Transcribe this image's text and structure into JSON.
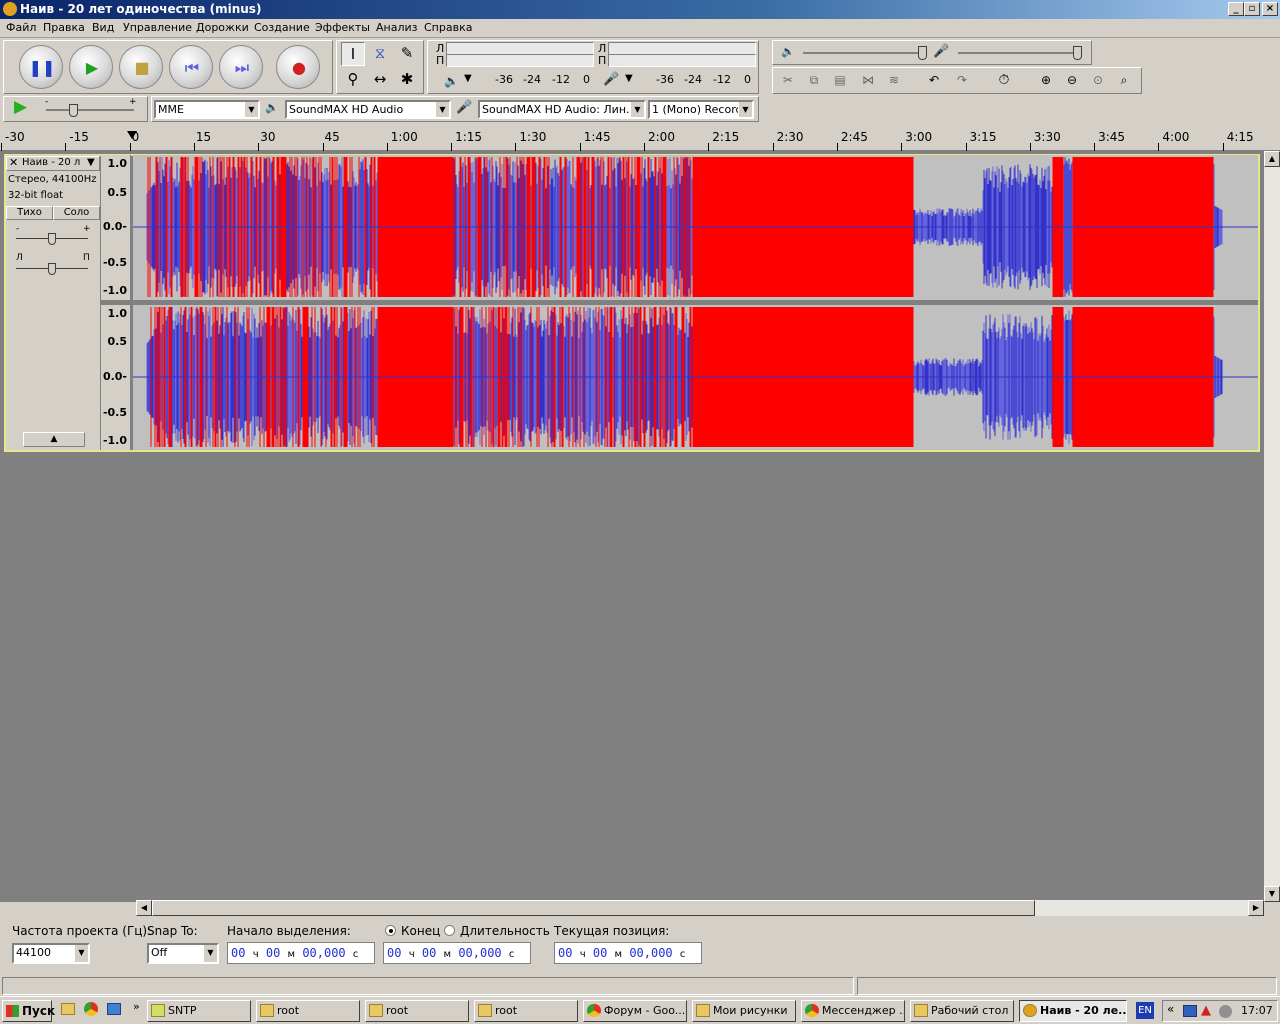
{
  "window": {
    "title": "Наив - 20 лет одиночества (minus)",
    "minimize": "_",
    "restore": "▫",
    "close": "×"
  },
  "menu": [
    "Файл",
    "Правка",
    "Вид",
    "Управление",
    "Дорожки",
    "Создание",
    "Эффекты",
    "Анализ",
    "Справка"
  ],
  "meters": {
    "play_channels": [
      "Л",
      "П"
    ],
    "rec_channels": [
      "Л",
      "П"
    ],
    "play_scale": [
      "-36",
      "-24",
      "-12",
      "0"
    ],
    "rec_scale": [
      "-36",
      "-24",
      "-12",
      "0"
    ]
  },
  "device": {
    "host": "MME",
    "output": "SoundMAX HD Audio",
    "input": "SoundMAX HD Audio: Лин. вход",
    "channels": "1 (Mono) Recording"
  },
  "playback_speed": {
    "minus": "-",
    "plus": "+"
  },
  "ruler": {
    "labels": [
      "-30",
      "-15",
      "0",
      "15",
      "30",
      "45",
      "1:00",
      "1:15",
      "1:30",
      "1:45",
      "2:00",
      "2:15",
      "2:30",
      "2:45",
      "3:00",
      "3:15",
      "3:30",
      "3:45",
      "4:00",
      "4:15"
    ]
  },
  "track": {
    "name": "Наив - 20 л",
    "format": "Стерео, 44100Hz",
    "bitdepth": "32-bit float",
    "mute": "Тихо",
    "solo": "Соло",
    "gain_minus": "-",
    "gain_plus": "+",
    "pan_left": "Л",
    "pan_right": "П",
    "scale": [
      "1.0",
      "0.5",
      "0.0-",
      "-0.5",
      "-1.0"
    ]
  },
  "selection": {
    "rate_label": "Частота проекта (Гц):",
    "rate_value": "44100",
    "snap_label": "Snap To:",
    "snap_value": "Off",
    "start_label": "Начало выделения:",
    "end_radio": "Конец",
    "length_radio": "Длительность",
    "position_label": "Текущая позиция:",
    "time_parts": {
      "h": "00",
      "hu": "ч",
      "m": "00",
      "mu": "м",
      "s": "00,000",
      "su": "с"
    }
  },
  "taskbar": {
    "start": "Пуск",
    "tasks": [
      "SNTP",
      "root",
      "root",
      "root",
      "Форум - Goo...",
      "Мои рисунки",
      "Мессенджер ...",
      "Рабочий стол",
      "Наив - 20 ле..."
    ],
    "lang": "EN",
    "clock": "17:07"
  }
}
